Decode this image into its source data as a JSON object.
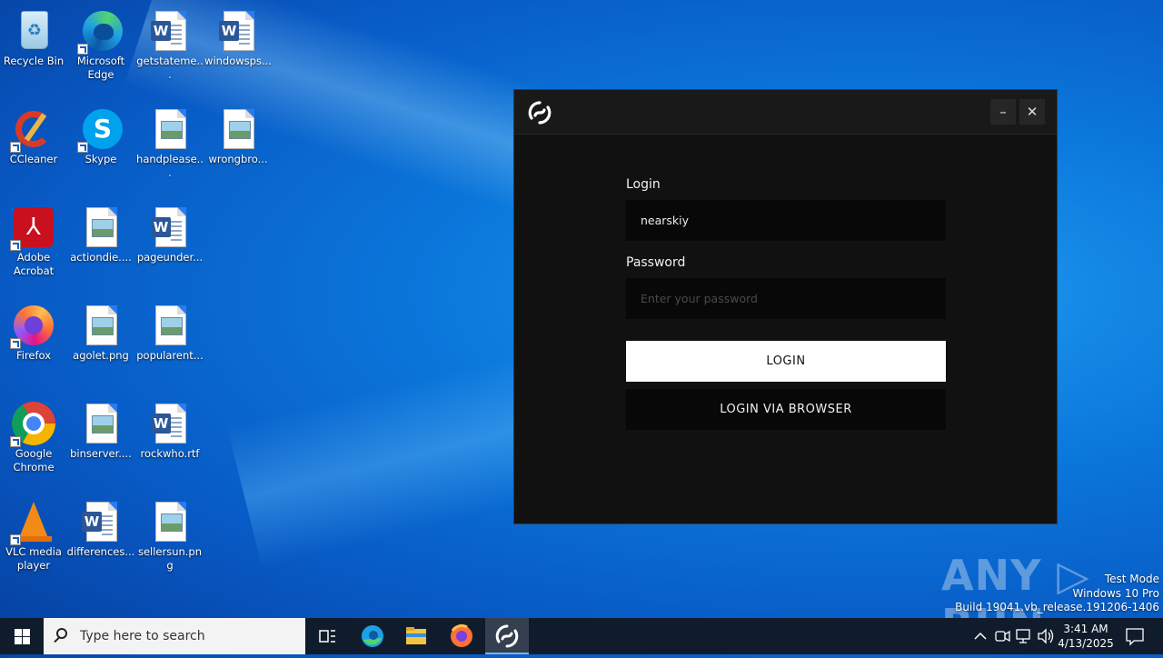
{
  "desktop_icons": [
    {
      "label": "Recycle Bin",
      "icon": "recycle-bin-icon"
    },
    {
      "label": "Microsoft Edge",
      "icon": "edge-icon"
    },
    {
      "label": "getstateme...",
      "icon": "word-doc-icon"
    },
    {
      "label": "windowsps...",
      "icon": "word-doc-icon"
    },
    {
      "label": "CCleaner",
      "icon": "ccleaner-icon"
    },
    {
      "label": "Skype",
      "icon": "skype-icon"
    },
    {
      "label": "handplease...",
      "icon": "image-file-icon"
    },
    {
      "label": "wrongbro...",
      "icon": "image-file-icon"
    },
    {
      "label": "Adobe Acrobat",
      "icon": "acrobat-icon"
    },
    {
      "label": "actiondie....",
      "icon": "image-file-icon"
    },
    {
      "label": "pageunder...",
      "icon": "word-doc-icon"
    },
    {
      "label": "Firefox",
      "icon": "firefox-icon"
    },
    {
      "label": "agolet.png",
      "icon": "image-file-icon"
    },
    {
      "label": "popularent...",
      "icon": "image-file-icon"
    },
    {
      "label": "Google Chrome",
      "icon": "chrome-icon"
    },
    {
      "label": "binserver....",
      "icon": "image-file-icon"
    },
    {
      "label": "rockwho.rtf",
      "icon": "word-doc-icon"
    },
    {
      "label": "VLC media player",
      "icon": "vlc-icon"
    },
    {
      "label": "differences...",
      "icon": "word-doc-icon"
    },
    {
      "label": "sellersun.png",
      "icon": "image-file-icon"
    }
  ],
  "app_window": {
    "minimize_label": "–",
    "close_label": "✕",
    "login_label": "Login",
    "login_value": "nearskiy",
    "password_label": "Password",
    "password_placeholder": "Enter your password",
    "login_button": "LOGIN",
    "browser_button": "LOGIN VIA BROWSER"
  },
  "watermark": {
    "brand": "ANY ▷ RUN",
    "line1": "Test Mode",
    "line2": "Windows 10 Pro",
    "line3": "Build 19041.vb_release.191206-1406"
  },
  "taskbar": {
    "search_placeholder": "Type here to search",
    "time": "3:41 AM",
    "date": "4/13/2025",
    "pinned": [
      "task-view-icon",
      "edge-icon",
      "file-explorer-icon",
      "firefox-icon",
      "app-logo-icon"
    ]
  },
  "colors": {
    "window_bg": "#111111",
    "field_bg": "#080808",
    "primary_button": "#ffffff",
    "taskbar": "#101c2c"
  }
}
